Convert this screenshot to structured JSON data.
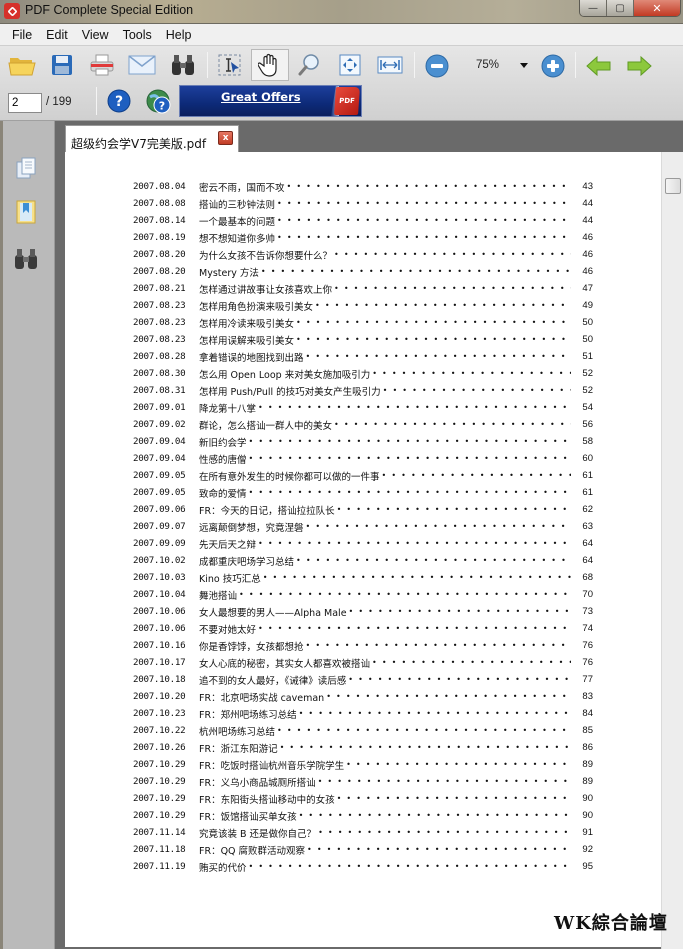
{
  "window": {
    "title": "PDF Complete Special Edition",
    "minimize_label": "—",
    "maximize_label": "▢",
    "close_label": "✕"
  },
  "menu": [
    "File",
    "Edit",
    "View",
    "Tools",
    "Help"
  ],
  "toolbar": {
    "icons": [
      "open-folder-icon",
      "save-icon",
      "print-icon",
      "email-icon",
      "find-binoculars-icon",
      "select-text-icon",
      "hand-tool-icon",
      "zoom-magnifier-icon",
      "fit-page-icon",
      "fit-width-icon",
      "zoom-out-icon",
      "zoom-in-icon",
      "previous-page-icon",
      "next-page-icon",
      "help-icon",
      "online-help-icon"
    ],
    "zoom_level": "75%",
    "current_page": "2",
    "total_pages": "/ 199",
    "banner_label": "Great Offers",
    "banner_badge": "PDF"
  },
  "document": {
    "tab_label": "超级约会学V7完美版.pdf",
    "tab_close": "x",
    "toc": [
      {
        "date": "2007.08.04",
        "title": "密云不雨，国而不攻",
        "page": "43"
      },
      {
        "date": "2007.08.08",
        "title": "搭讪的三秒钟法则",
        "page": "44"
      },
      {
        "date": "2007.08.14",
        "title": "一个最基本的问题",
        "page": "44"
      },
      {
        "date": "2007.08.19",
        "title": "想不想知道你多帅",
        "page": "46"
      },
      {
        "date": "2007.08.20",
        "title": "为什么女孩不告诉你想要什么？",
        "page": "46"
      },
      {
        "date": "2007.08.20",
        "title": "Mystery 方法",
        "page": "46"
      },
      {
        "date": "2007.08.21",
        "title": "怎样通过讲故事让女孩喜欢上你",
        "page": "47"
      },
      {
        "date": "2007.08.23",
        "title": "怎样用角色扮演来吸引美女",
        "page": "49"
      },
      {
        "date": "2007.08.23",
        "title": "怎样用冷读来吸引美女",
        "page": "50"
      },
      {
        "date": "2007.08.23",
        "title": "怎样用误解来吸引美女",
        "page": "50"
      },
      {
        "date": "2007.08.28",
        "title": "拿着错误的地图找到出路",
        "page": "51"
      },
      {
        "date": "2007.08.30",
        "title": "怎么用 Open Loop 来对美女施加吸引力",
        "page": "52"
      },
      {
        "date": "2007.08.31",
        "title": "怎样用 Push/Pull 的技巧对美女产生吸引力",
        "page": "52"
      },
      {
        "date": "2007.09.01",
        "title": "降龙第十八掌",
        "page": "54"
      },
      {
        "date": "2007.09.02",
        "title": "群论，怎么搭讪一群人中的美女",
        "page": "56"
      },
      {
        "date": "2007.09.04",
        "title": "新旧约会学",
        "page": "58"
      },
      {
        "date": "2007.09.04",
        "title": "性感的唐僧",
        "page": "60"
      },
      {
        "date": "2007.09.05",
        "title": "在所有意外发生的时候你都可以做的一件事",
        "page": "61"
      },
      {
        "date": "2007.09.05",
        "title": "致命的爱情",
        "page": "61"
      },
      {
        "date": "2007.09.06",
        "title": "FR：今天的日记，搭讪拉拉队长",
        "page": "62"
      },
      {
        "date": "2007.09.07",
        "title": "远离颠倒梦想，究竟涅磐",
        "page": "63"
      },
      {
        "date": "2007.09.09",
        "title": "先天后天之辩",
        "page": "64"
      },
      {
        "date": "2007.10.02",
        "title": "成都重庆吧场学习总结",
        "page": "64"
      },
      {
        "date": "2007.10.03",
        "title": "Kino 技巧汇总",
        "page": "68"
      },
      {
        "date": "2007.10.04",
        "title": "舞池搭讪",
        "page": "70"
      },
      {
        "date": "2007.10.06",
        "title": "女人最想要的男人——Alpha Male",
        "page": "73"
      },
      {
        "date": "2007.10.06",
        "title": "不要对她太好",
        "page": "74"
      },
      {
        "date": "2007.10.16",
        "title": "你是香饽饽，女孩都想抢",
        "page": "76"
      },
      {
        "date": "2007.10.17",
        "title": "女人心底的秘密，其实女人都喜欢被搭讪",
        "page": "76"
      },
      {
        "date": "2007.10.18",
        "title": "追不到的女人最好，《诫律》读后感",
        "page": "77"
      },
      {
        "date": "2007.10.20",
        "title": "FR：北京吧场实战 caveman",
        "page": "83"
      },
      {
        "date": "2007.10.23",
        "title": "FR：郑州吧场练习总结",
        "page": "84"
      },
      {
        "date": "2007.10.22",
        "title": "杭州吧场练习总结",
        "page": "85"
      },
      {
        "date": "2007.10.26",
        "title": "FR：浙江东阳游记",
        "page": "86"
      },
      {
        "date": "2007.10.29",
        "title": "FR：吃饭时搭讪杭州音乐学院学生",
        "page": "89"
      },
      {
        "date": "2007.10.29",
        "title": "FR：义乌小商品城厕所搭讪",
        "page": "89"
      },
      {
        "date": "2007.10.29",
        "title": "FR：东阳街头搭讪移动中的女孩",
        "page": "90"
      },
      {
        "date": "2007.10.29",
        "title": "FR：饭馆搭讪买单女孩",
        "page": "90"
      },
      {
        "date": "2007.11.14",
        "title": "究竟该装 B 还是做你自己？",
        "page": "91"
      },
      {
        "date": "2007.11.18",
        "title": "FR：QQ 腐败群活动观察",
        "page": "92"
      },
      {
        "date": "2007.11.19",
        "title": "贿买的代价",
        "page": "95"
      }
    ],
    "dot_leader": "••••••••••••••••••••••••••••••••••••••••••••••••••••••••••••••••••••"
  },
  "watermark": "WK綜合論壇",
  "colors": {
    "close_red": "#c23a23",
    "banner_blue": "#0d2a78",
    "nav_green": "#8cc83c",
    "zoom_blue": "#4a8fd0"
  }
}
